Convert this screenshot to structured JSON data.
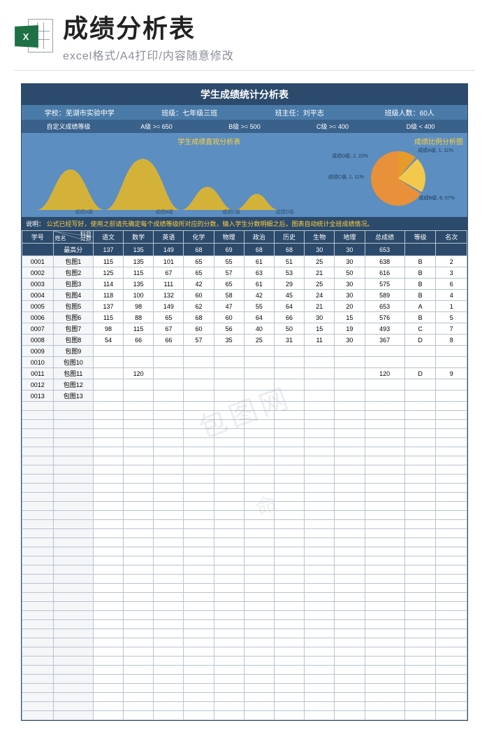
{
  "top": {
    "icon_letter": "X",
    "title": "成绩分析表",
    "subtitle": "excel格式/A4打印/内容随意修改"
  },
  "header": {
    "main_title": "学生成绩统计分析表",
    "school": "学校：芜湖市实验中学",
    "class": "班级：七年级三班",
    "teacher": "班主任：刘平志",
    "count": "班级人数：60人",
    "grade_label": "自定义成绩等级",
    "grade_a": "A级 >= 650",
    "grade_b": "B级 >= 500",
    "grade_c": "C级 >= 400",
    "grade_d": "D级 < 400",
    "chart_title_1": "学生成绩直观分析表",
    "chart_title_2": "成绩比例分析图",
    "hump_labels": [
      "成绩A级",
      "成绩B级",
      "成绩C级",
      "成绩D级"
    ],
    "pie_labels": {
      "a": "成绩A级, 1, 11%",
      "b": "成绩B级, 6, 67%",
      "c": "成绩C级, 1, 11%",
      "d": "成绩D级, 2, 22%"
    },
    "note_label": "说明：",
    "note_text": "公式已经写好，使用之前请先确定每个成绩等级所对应的分数，输入学生分数明细之后，图表自动统计全班成绩情况。"
  },
  "table": {
    "corner": {
      "subject": "科目",
      "name": "姓名",
      "score": "分数"
    },
    "cols": [
      "学号",
      "",
      "语文",
      "数学",
      "英语",
      "化学",
      "物理",
      "政治",
      "历史",
      "生物",
      "地理",
      "总成绩",
      "等级",
      "名次"
    ],
    "maxrow_label": "最高分",
    "maxrow": [
      "137",
      "135",
      "149",
      "68",
      "69",
      "68",
      "68",
      "30",
      "30",
      "653",
      "",
      ""
    ],
    "rows": [
      {
        "id": "0001",
        "name": "包图1",
        "c": [
          "115",
          "135",
          "101",
          "65",
          "55",
          "61",
          "51",
          "25",
          "30",
          "638",
          "B",
          "2"
        ]
      },
      {
        "id": "0002",
        "name": "包图2",
        "c": [
          "125",
          "115",
          "67",
          "65",
          "57",
          "63",
          "53",
          "21",
          "50",
          "616",
          "B",
          "3"
        ]
      },
      {
        "id": "0003",
        "name": "包图3",
        "c": [
          "114",
          "135",
          "111",
          "42",
          "65",
          "61",
          "29",
          "25",
          "30",
          "575",
          "B",
          "6"
        ]
      },
      {
        "id": "0004",
        "name": "包图4",
        "c": [
          "118",
          "100",
          "132",
          "60",
          "58",
          "42",
          "45",
          "24",
          "30",
          "589",
          "B",
          "4"
        ]
      },
      {
        "id": "0005",
        "name": "包图5",
        "c": [
          "137",
          "98",
          "149",
          "62",
          "47",
          "55",
          "64",
          "21",
          "20",
          "653",
          "A",
          "1"
        ]
      },
      {
        "id": "0006",
        "name": "包图6",
        "c": [
          "115",
          "88",
          "65",
          "68",
          "60",
          "64",
          "66",
          "30",
          "15",
          "576",
          "B",
          "5"
        ]
      },
      {
        "id": "0007",
        "name": "包图7",
        "c": [
          "98",
          "115",
          "67",
          "60",
          "56",
          "40",
          "50",
          "15",
          "19",
          "493",
          "C",
          "7"
        ]
      },
      {
        "id": "0008",
        "name": "包图8",
        "c": [
          "54",
          "66",
          "66",
          "57",
          "35",
          "25",
          "31",
          "11",
          "30",
          "367",
          "D",
          "8"
        ]
      },
      {
        "id": "0009",
        "name": "包图9",
        "c": [
          "",
          "",
          "",
          "",
          "",
          "",
          "",
          "",
          "",
          "",
          "",
          ""
        ]
      },
      {
        "id": "0010",
        "name": "包图10",
        "c": [
          "",
          "",
          "",
          "",
          "",
          "",
          "",
          "",
          "",
          "",
          "",
          ""
        ]
      },
      {
        "id": "0011",
        "name": "包图11",
        "c": [
          "",
          "120",
          "",
          "",
          "",
          "",
          "",
          "",
          "",
          "120",
          "D",
          "9"
        ]
      },
      {
        "id": "0012",
        "name": "包图12",
        "c": [
          "",
          "",
          "",
          "",
          "",
          "",
          "",
          "",
          "",
          "",
          "",
          ""
        ]
      },
      {
        "id": "0013",
        "name": "包图13",
        "c": [
          "",
          "",
          "",
          "",
          "",
          "",
          "",
          "",
          "",
          "",
          "",
          ""
        ]
      }
    ]
  },
  "chart_data": [
    {
      "type": "area",
      "title": "学生成绩直观分析表",
      "categories": [
        "成绩A级",
        "成绩B级",
        "成绩C级",
        "成绩D级"
      ],
      "values": [
        1,
        6,
        1,
        2
      ],
      "xlabel": "",
      "ylabel": ""
    },
    {
      "type": "pie",
      "title": "成绩比例分析图",
      "categories": [
        "成绩A级",
        "成绩B级",
        "成绩C级",
        "成绩D级"
      ],
      "values": [
        1,
        6,
        1,
        2
      ],
      "percent": [
        11,
        67,
        11,
        22
      ]
    }
  ],
  "watermark": "包图网",
  "watermark2": "命"
}
